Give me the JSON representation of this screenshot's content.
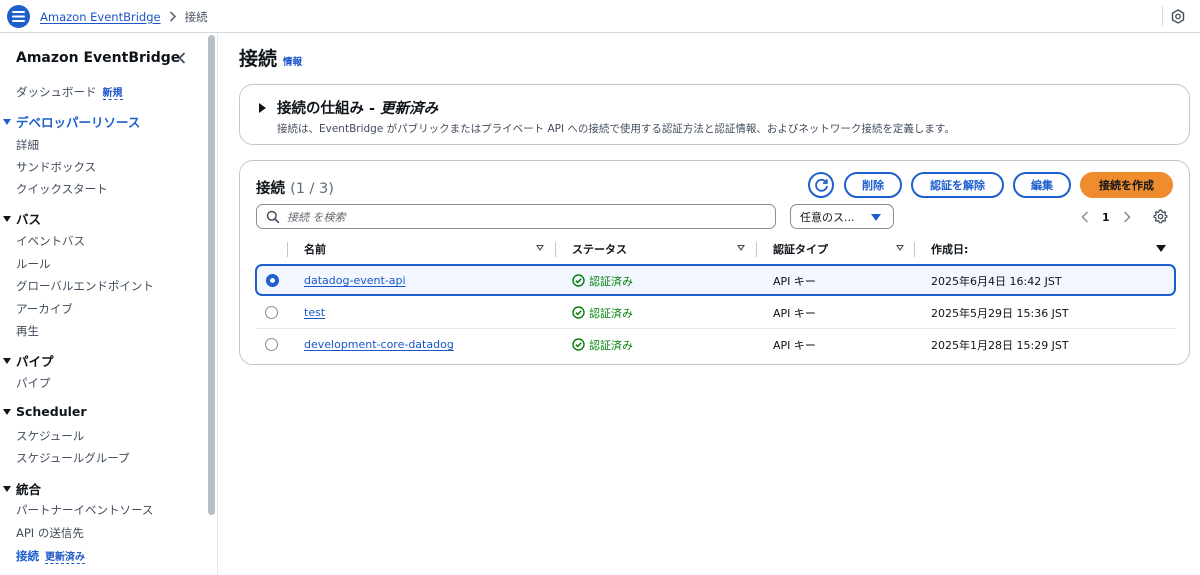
{
  "topbar": {
    "breadcrumb_service": "Amazon EventBridge",
    "breadcrumb_current": "接続"
  },
  "sidebar": {
    "title": "Amazon EventBridge",
    "dashboard": {
      "label": "ダッシュボード",
      "badge": "新規"
    },
    "sections": [
      {
        "title": "デベロッパーリソース",
        "items": [
          "詳細",
          "サンドボックス",
          "クイックスタート"
        ]
      },
      {
        "title": "バス",
        "items": [
          "イベントバス",
          "ルール",
          "グローバルエンドポイント",
          "アーカイブ",
          "再生"
        ]
      },
      {
        "title": "パイプ",
        "items": [
          "パイプ"
        ]
      },
      {
        "title": "Scheduler",
        "items": [
          "スケジュール",
          "スケジュールグループ"
        ]
      },
      {
        "title": "統合",
        "items": [
          "パートナーイベントソース",
          "API の送信先"
        ]
      }
    ],
    "connections_item": {
      "label": "接続",
      "badge": "更新済み"
    }
  },
  "main": {
    "title": "接続",
    "info_link": "情報",
    "info_panel": {
      "heading": "接続の仕組み - ",
      "heading_emph": "更新済み",
      "description": "接続は、EventBridge がパブリックまたはプライベート API への接続で使用する認証方法と認証情報、およびネットワーク接続を定義します。"
    },
    "table": {
      "title": "接続",
      "count": "(1 / 3)",
      "buttons": {
        "delete": "削除",
        "deauthorize": "認証を解除",
        "edit": "編集",
        "create": "接続を作成"
      },
      "search_placeholder": "接続 を検索",
      "filter_value": "任意のス...",
      "page": "1",
      "columns": [
        "名前",
        "ステータス",
        "認証タイプ",
        "作成日:"
      ],
      "rows": [
        {
          "name": "datadog-event-api",
          "status": "認証済み",
          "auth": "API キー",
          "created": "2025年6月4日 16:42 JST",
          "selected": true
        },
        {
          "name": "test",
          "status": "認証済み",
          "auth": "API キー",
          "created": "2025年5月29日 15:36 JST",
          "selected": false
        },
        {
          "name": "development-core-datadog",
          "status": "認証済み",
          "auth": "API キー",
          "created": "2025年1月28日 15:29 JST",
          "selected": false
        }
      ]
    }
  },
  "colors": {
    "accent": "#1e5fce",
    "primary_button": "#ef8d2e",
    "status_success": "#037f0c",
    "link": "#1c55c8"
  },
  "icons": {
    "menu": "hamburger-icon",
    "breadcrumb_sep": "chevron-right-icon",
    "top_right": "notification-hexagon-icon",
    "sidebar_collapse": "chevron-left-icon",
    "refresh": "refresh-icon",
    "search": "search-icon",
    "settings": "gear-icon",
    "status": "check-circle-icon"
  }
}
